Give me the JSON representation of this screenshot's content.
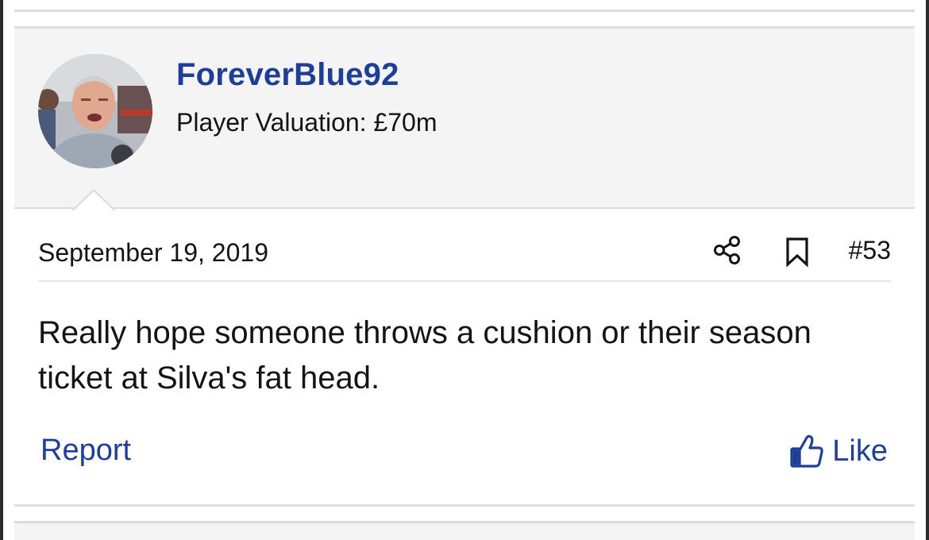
{
  "post": {
    "user": {
      "name": "ForeverBlue92",
      "title": "Player Valuation: £70m",
      "avatar_icon": "user-avatar-photo"
    },
    "date": "September 19, 2019",
    "number": "#53",
    "message": "Really hope someone throws a cushion or their season ticket at Silva's fat head.",
    "actions": {
      "report_label": "Report",
      "like_label": "Like"
    },
    "icons": {
      "share": "share-icon",
      "bookmark": "bookmark-icon",
      "like": "thumbs-up-icon"
    }
  },
  "colors": {
    "accent": "#1f3f96",
    "text": "#141414",
    "header_bg": "#f4f4f4",
    "divider": "#dcdcdc"
  }
}
